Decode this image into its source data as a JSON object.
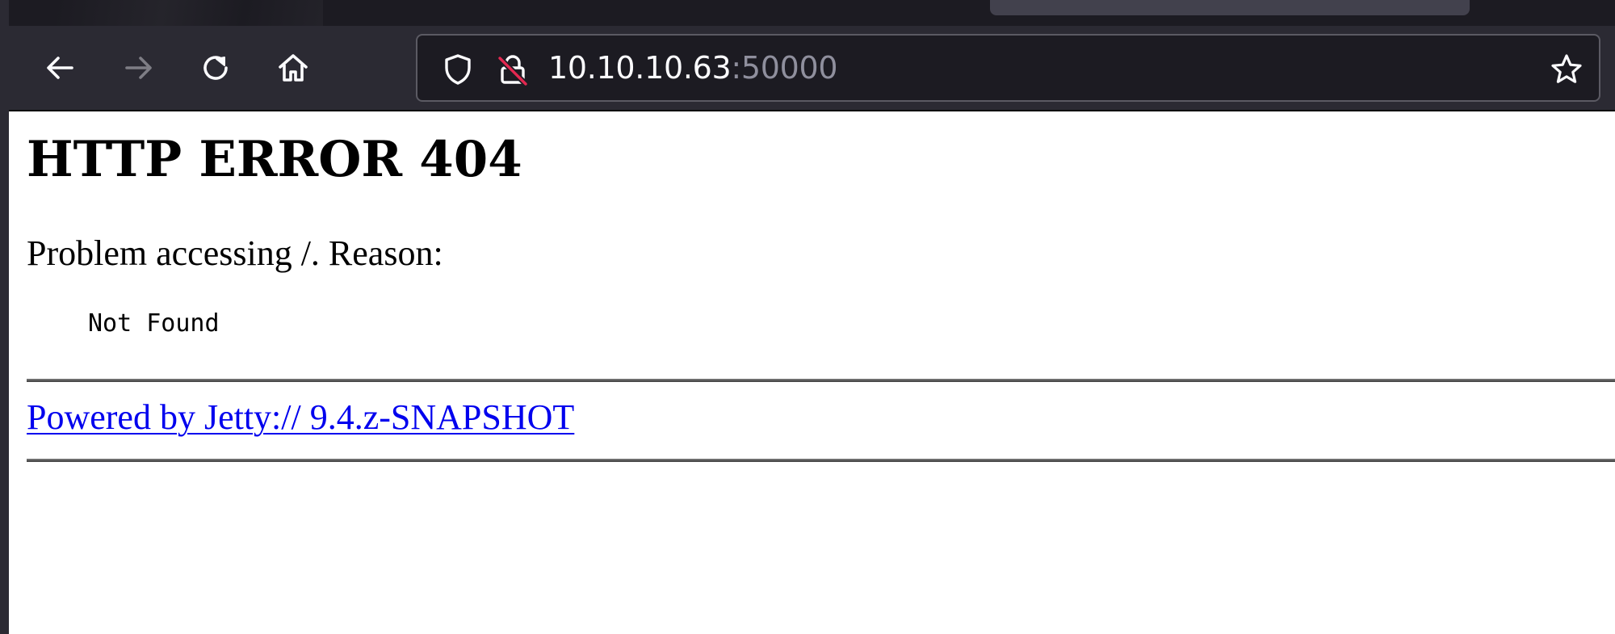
{
  "browser": {
    "toolbar": {
      "back_icon": "back-arrow-icon",
      "forward_icon": "forward-arrow-icon",
      "reload_icon": "reload-icon",
      "home_icon": "home-icon",
      "forward_enabled": false
    },
    "urlbar": {
      "host": "10.10.10.63",
      "port": ":50000",
      "tracking_icon": "shield-icon",
      "security_icon": "insecure-lock-icon",
      "bookmark_icon": "star-icon"
    },
    "colors": {
      "toolbar_bg": "#2b2a33",
      "urlbar_bg": "#1c1b22",
      "insecure_slash": "#e22850"
    }
  },
  "page": {
    "title": "HTTP ERROR 404",
    "problem": "Problem accessing /. Reason:",
    "reason": "Not Found",
    "powered_by": "Powered by Jetty:// 9.4.z-SNAPSHOT",
    "link_color": "#0000ee"
  }
}
